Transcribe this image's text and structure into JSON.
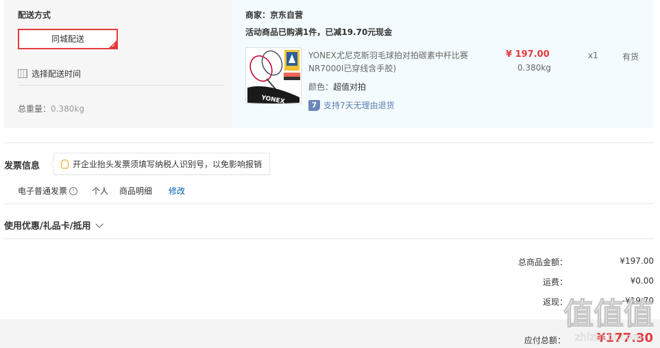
{
  "delivery": {
    "title": "配送方式",
    "method": "同城配送",
    "time_label": "选择配送时间",
    "total_weight_label": "总重量：",
    "total_weight_value": "0.380kg"
  },
  "merchant": {
    "label": "商家：京东自营",
    "promo": "活动商品已购满1件，已减19.70元现金"
  },
  "item": {
    "name": "YONEX尤尼克斯羽毛球拍对拍碳素中杆比赛NR7000I已穿线含手胶)",
    "color_label": "颜色：",
    "color_value": "超值对拍",
    "return_icon_text": "7",
    "return_text": "支持7天无理由退货",
    "price": "¥ 197.00",
    "weight": "0.380kg",
    "qty": "x1",
    "stock": "有货",
    "brand_mark": "YONEX"
  },
  "invoice": {
    "title": "发票信息",
    "tip": "开企业抬头发票须填写纳税人识别号，以免影响报销",
    "type": "电子普通发票",
    "person": "个人",
    "detail": "商品明细",
    "edit": "修改"
  },
  "coupon": {
    "label": "使用优惠/礼品卡/抵用"
  },
  "summary": {
    "goods_label": "总商品金额：",
    "goods_value": "¥197.00",
    "freight_label": "运费：",
    "freight_value": "¥0.00",
    "rebate_label": "返现：",
    "rebate_value": "-¥19.70",
    "total_label": "应付总额：",
    "total_value": "¥177.30"
  },
  "watermark": {
    "main": "值值值",
    "sub": "zhizhi.bi.com"
  },
  "colors": {
    "accent_red": "#e4393c",
    "link_blue": "#005ea7",
    "panel_gray": "#f6f6f6",
    "panel_blue": "#f3fbfe"
  }
}
